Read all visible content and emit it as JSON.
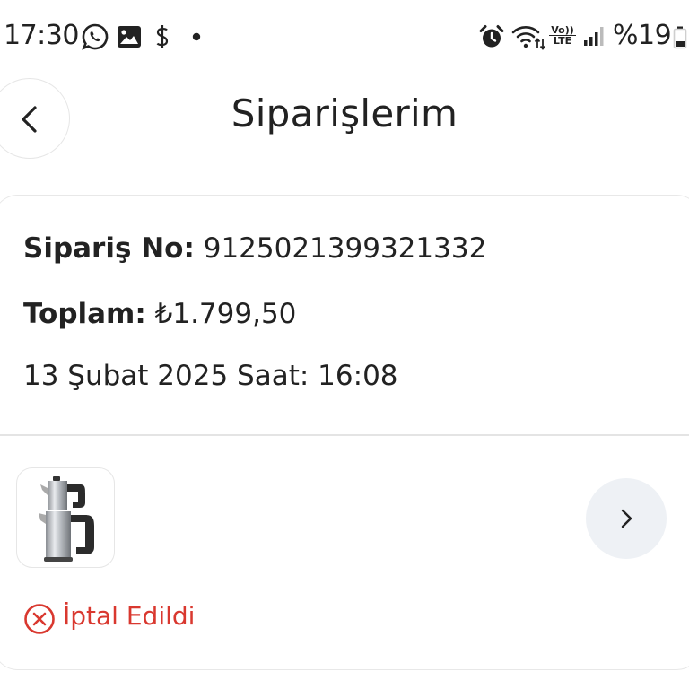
{
  "status_bar": {
    "time": "17:30",
    "network_label": "Vo))\nLTE",
    "network_line1": "Vo))",
    "network_line2": "LTE",
    "battery": "%19",
    "icons": [
      "whatsapp-icon",
      "gallery-icon",
      "dollar-icon",
      "dot-icon",
      "alarm-icon",
      "wifi-icon",
      "volte-icon",
      "signal-icon",
      "battery-icon"
    ]
  },
  "header": {
    "title": "Siparişlerim",
    "back_icon": "chevron-left-icon"
  },
  "order": {
    "number_label": "Sipariş No:",
    "number_value": "9125021399321332",
    "total_label": "Toplam:",
    "total_value": "₺1.799,50",
    "date": "13 Şubat 2025 Saat: 16:08",
    "product_icon": "kettle-icon",
    "detail_icon": "chevron-right-icon",
    "status_icon": "cancel-circle-icon",
    "status": "İptal Edildi"
  },
  "colors": {
    "text": "#222222",
    "cancel_red": "#d9382f",
    "border": "#e6e6e6",
    "detail_button_bg": "#eef1f5"
  }
}
